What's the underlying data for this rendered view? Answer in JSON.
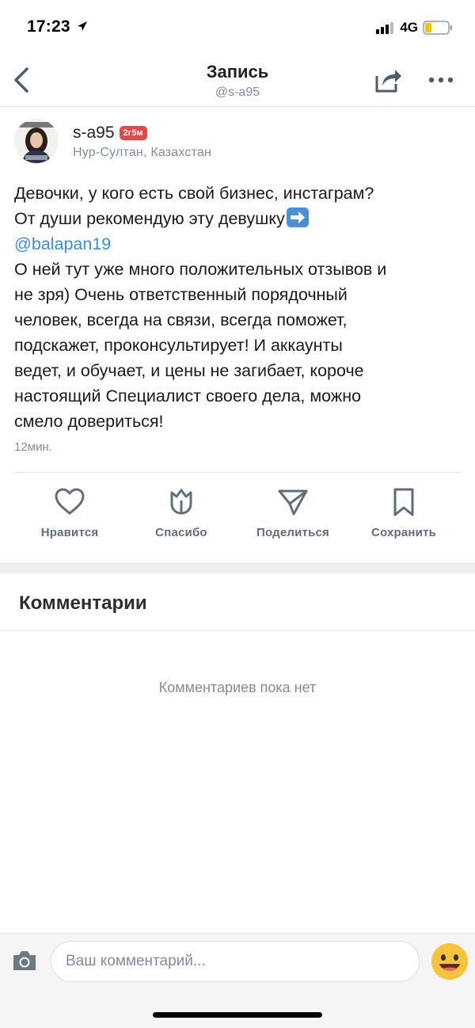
{
  "status_bar": {
    "time": "17:23",
    "network": "4G"
  },
  "header": {
    "title": "Запись",
    "subtitle": "@s-a95"
  },
  "post": {
    "author": "s-a95",
    "badge": "2г5м",
    "location": "Нур-Султан, Казахстан",
    "text_lines": [
      "Девочки, у кого есть свой бизнес, инстаграм?",
      "От души рекомендую эту девушку",
      "@balapan19",
      "О ней тут уже много положительных отзывов и",
      "не зря) Очень ответственный порядочный",
      "человек, всегда на связи, всегда поможет,",
      "подскажет, проконсультирует! И аккаунты",
      "ведет, и обучает, и цены не загибает, короче",
      "настоящий Специалист своего дела, можно",
      "смело довериться!"
    ],
    "time": "12мин."
  },
  "actions": {
    "like": "Нравится",
    "thanks": "Спасибо",
    "share": "Поделиться",
    "save": "Сохранить"
  },
  "comments": {
    "title": "Комментарии",
    "empty": "Комментариев пока нет"
  },
  "composer": {
    "placeholder": "Ваш комментарий..."
  },
  "colors": {
    "accent": "#3f8ae0",
    "badge": "#e64646",
    "icon": "#626d7a",
    "emoji": "#f7c33c"
  }
}
